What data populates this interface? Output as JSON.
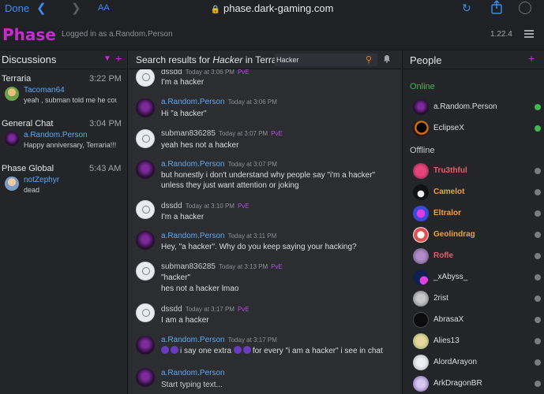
{
  "browser": {
    "done_label": "Done",
    "text_size_label": "AA",
    "url": "phase.dark-gaming.com"
  },
  "app": {
    "logo": "Phase",
    "logged_in": "Logged in as a.Random.Person",
    "version": "1.22.4"
  },
  "discussions": {
    "title": "Discussions",
    "items": [
      {
        "name": "Terraria",
        "time": "3:22 PM",
        "user": "Tacoman64",
        "preview": "yeah , subman told me he could"
      },
      {
        "name": "General Chat",
        "time": "3:04 PM",
        "user": "a.Random.Person",
        "preview": "Happy anniversary, Terraria!!!"
      },
      {
        "name": "Phase Global",
        "time": "5:43 AM",
        "user": "notZephyr",
        "preview": "dead"
      }
    ]
  },
  "search": {
    "title_prefix": "Search results for ",
    "term": "Hacker",
    "title_in": " in ",
    "title_channel": "Terraria",
    "field_value": "Hacker"
  },
  "messages": [
    {
      "user": "dssdd",
      "time": "Today at 3:06 PM",
      "badge": "PvE",
      "text": "I'm a hacker",
      "type": "robot"
    },
    {
      "user": "a.Random.Person",
      "time": "Today at 3:06 PM",
      "badge": "",
      "text": "Hi \"a hacker\"",
      "type": "arp"
    },
    {
      "user": "subman836285",
      "time": "Today at 3:07 PM",
      "badge": "PvE",
      "text": "yeah hes not a hacker",
      "type": "robot"
    },
    {
      "user": "a.Random.Person",
      "time": "Today at 3:07 PM",
      "badge": "",
      "text": "but honestly i don't understand why people say \"i'm a hacker\" unless they just want attention or joking",
      "type": "arp"
    },
    {
      "user": "dssdd",
      "time": "Today at 3:10 PM",
      "badge": "PvE",
      "text": "I'm a hacker",
      "type": "robot"
    },
    {
      "user": "a.Random.Person",
      "time": "Today at 3:11 PM",
      "badge": "",
      "text": "Hey, \"a hacker\". Why do you keep saying your hacking?",
      "type": "arp"
    },
    {
      "user": "subman836285",
      "time": "Today at 3:13 PM",
      "badge": "PvE",
      "text": "\"hacker\"",
      "text2": "hes not a hacker lmao",
      "type": "robot"
    },
    {
      "user": "dssdd",
      "time": "Today at 3:17 PM",
      "badge": "PvE",
      "text": "I am a hacker",
      "type": "robot"
    },
    {
      "user": "a.Random.Person",
      "time": "Today at 3:17 PM",
      "badge": "",
      "text": "i say one extra",
      "text_b": "for every \"i am a hacker\" i see in chat",
      "type": "arp"
    },
    {
      "user": "a.Random.Person",
      "time": "",
      "badge": "",
      "text": "Start typing text...",
      "type": "arp"
    }
  ],
  "people": {
    "title": "People",
    "online_label": "Online",
    "offline_label": "Offline",
    "online": [
      {
        "name": "a.Random.Person",
        "color": "#dcddde"
      },
      {
        "name": "EclipseX",
        "color": "#dcddde"
      }
    ],
    "offline": [
      {
        "name": "Tru3thful",
        "color": "#e0606a"
      },
      {
        "name": "Camelot",
        "color": "#f0a040"
      },
      {
        "name": "Eltralor",
        "color": "#f0a040"
      },
      {
        "name": "Geolindrag",
        "color": "#f0a040"
      },
      {
        "name": "Rofle",
        "color": "#e0606a"
      },
      {
        "name": "_xAbyss_",
        "color": "#dcddde"
      },
      {
        "name": "2rist",
        "color": "#dcddde"
      },
      {
        "name": "AbrasaX",
        "color": "#dcddde"
      },
      {
        "name": "Alies13",
        "color": "#dcddde"
      },
      {
        "name": "AlordArayon",
        "color": "#dcddde"
      },
      {
        "name": "ArkDragonBR",
        "color": "#dcddde"
      }
    ]
  },
  "colors": {
    "accent": "#c62ccf",
    "link_blue": "#5fa8ef",
    "online_green": "#3fb950",
    "pve_purple": "#b54fe0",
    "search_orange": "#e8841a"
  }
}
